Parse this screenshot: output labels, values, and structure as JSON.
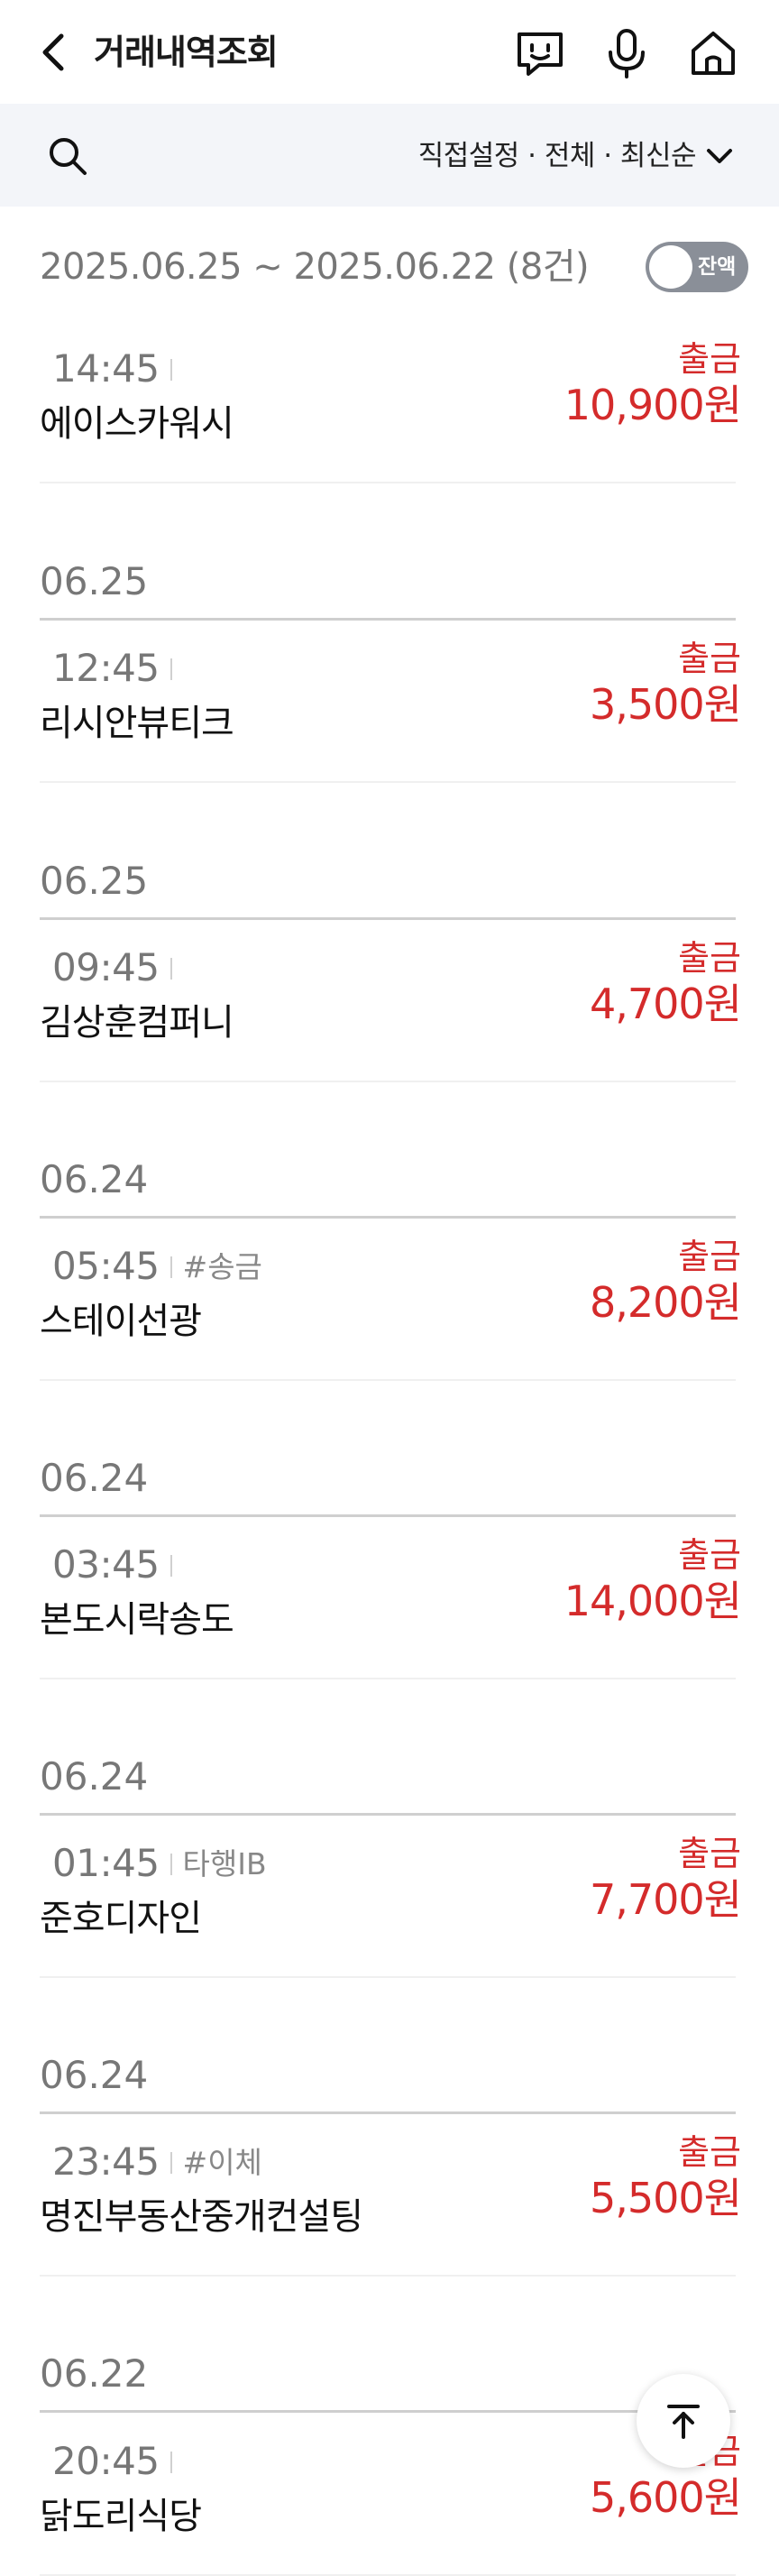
{
  "header": {
    "title": "거래내역조회",
    "icons": [
      "back-icon",
      "chatbot-icon",
      "mic-icon",
      "home-icon"
    ]
  },
  "filter": {
    "label": "직접설정 · 전체 · 최신순"
  },
  "range": {
    "text": "2025.06.25 ~ 2025.06.22 (8건)",
    "toggle_label": "잔액"
  },
  "colors": {
    "withdraw": "#d42b2b",
    "filter_bg": "#f3f5f9"
  },
  "transactions": [
    {
      "time": "14:45",
      "tag": "",
      "merchant": "에이스카워시",
      "kind": "출금",
      "amount": "10,900원"
    },
    {
      "date": "06.25",
      "time": "12:45",
      "tag": "",
      "merchant": "리시안뷰티크",
      "kind": "출금",
      "amount": "3,500원"
    },
    {
      "date": "06.25",
      "time": "09:45",
      "tag": "",
      "merchant": "김상훈컴퍼니",
      "kind": "출금",
      "amount": "4,700원"
    },
    {
      "date": "06.24",
      "time": "05:45",
      "tag": "#송금",
      "merchant": "스테이선광",
      "kind": "출금",
      "amount": "8,200원"
    },
    {
      "date": "06.24",
      "time": "03:45",
      "tag": "",
      "merchant": "본도시락송도",
      "kind": "출금",
      "amount": "14,000원"
    },
    {
      "date": "06.24",
      "time": "01:45",
      "tag": "타행IB",
      "merchant": "준호디자인",
      "kind": "출금",
      "amount": "7,700원"
    },
    {
      "date": "06.24",
      "time": "23:45",
      "tag": "#이체",
      "merchant": "명진부동산중개컨설팅",
      "kind": "출금",
      "amount": "5,500원"
    },
    {
      "date": "06.22",
      "time": "20:45",
      "tag": "",
      "merchant": "닭도리식당",
      "kind": "출금",
      "amount": "5,600원"
    }
  ]
}
